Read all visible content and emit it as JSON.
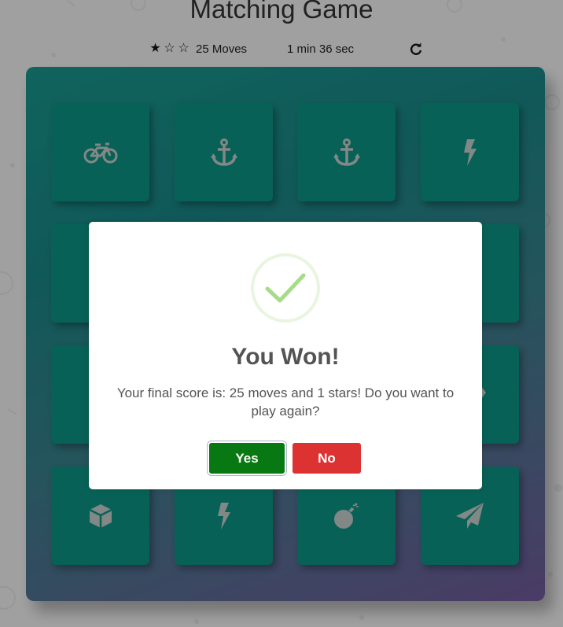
{
  "game": {
    "title": "Matching Game",
    "stars": {
      "earned": 1,
      "total": 3,
      "filled_glyph": "★",
      "empty_glyph": "☆"
    },
    "moves_text": "25 Moves",
    "timer_text": "1 min 36 sec",
    "restart_icon": "refresh-icon"
  },
  "deck": {
    "rows": [
      [
        {
          "icon": "bicycle-icon"
        },
        {
          "icon": "anchor-icon"
        },
        {
          "icon": "anchor-icon"
        },
        {
          "icon": "bolt-icon"
        }
      ],
      [
        {
          "icon": "hidden"
        },
        {
          "icon": "hidden"
        },
        {
          "icon": "hidden"
        },
        {
          "icon": "hidden"
        }
      ],
      [
        {
          "icon": "hidden"
        },
        {
          "icon": "hidden"
        },
        {
          "icon": "hidden"
        },
        {
          "icon": "hidden"
        }
      ],
      [
        {
          "icon": "cube-icon"
        },
        {
          "icon": "bolt-icon"
        },
        {
          "icon": "bomb-icon"
        },
        {
          "icon": "paper-plane-icon"
        }
      ]
    ]
  },
  "modal": {
    "icon": "success-check-icon",
    "title": "You Won!",
    "message": "Your final score is: 25 moves and 1 stars! Do you want to play again?",
    "confirm_label": "Yes",
    "cancel_label": "No"
  },
  "colors": {
    "card": "#0b7a6c",
    "card_icon": "#a2aaa8",
    "confirm": "#087813",
    "cancel": "#dd3232",
    "check": "#a5dc86"
  }
}
